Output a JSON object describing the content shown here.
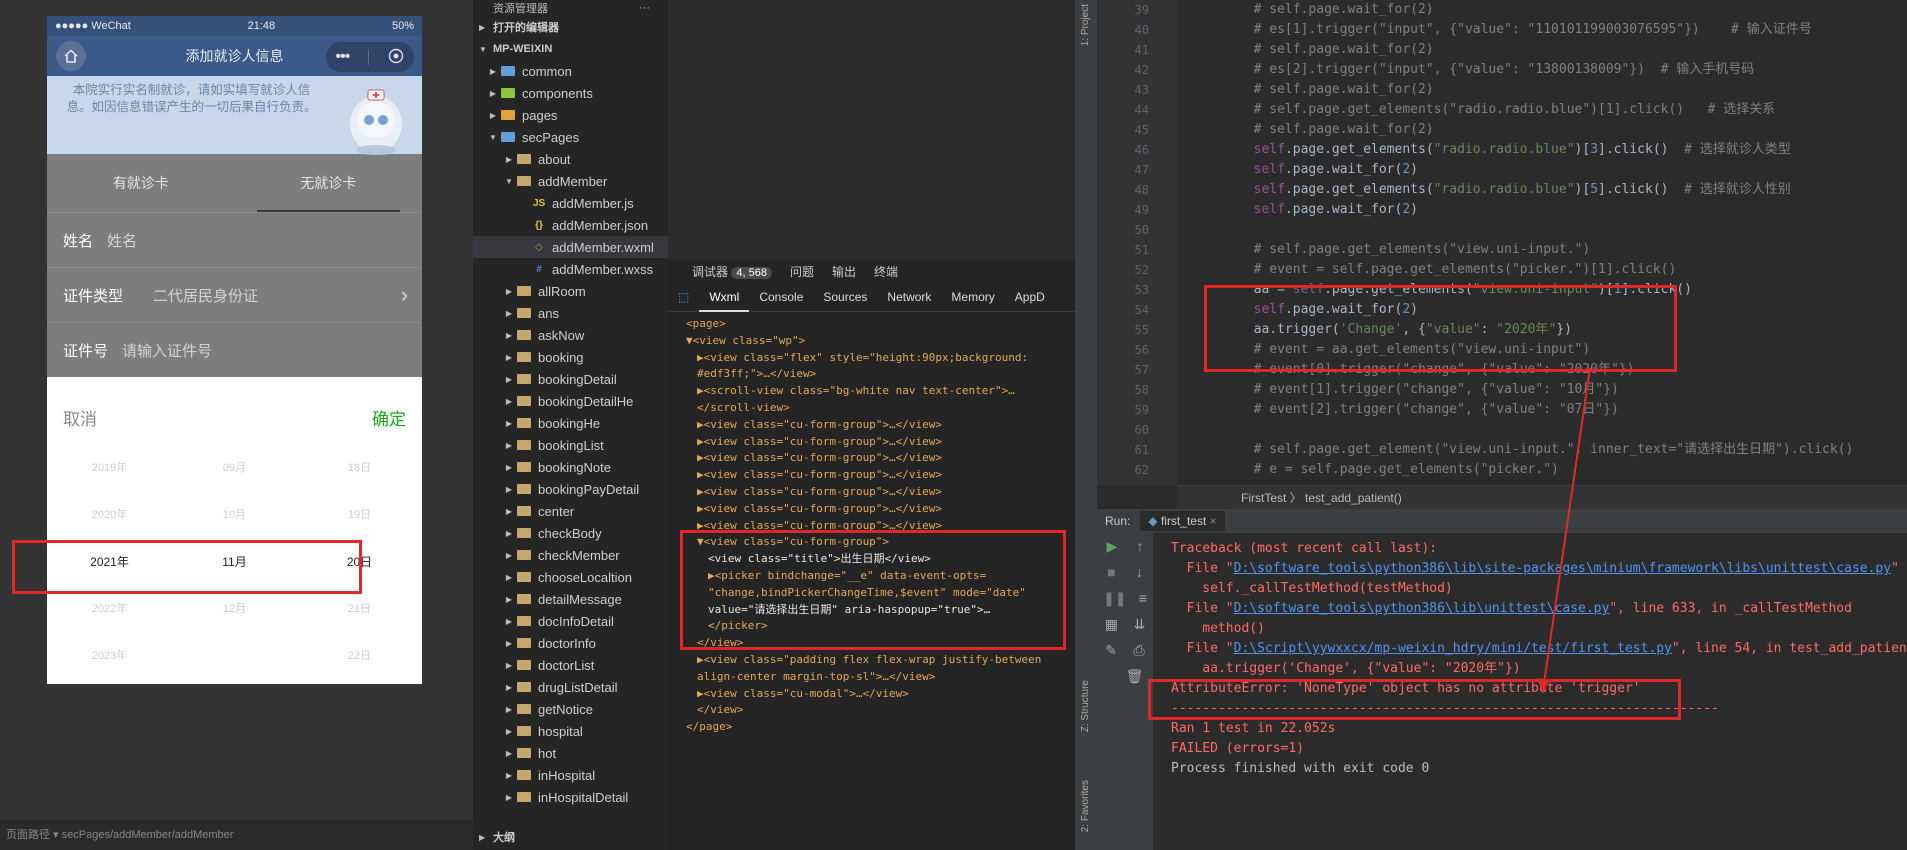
{
  "simulator": {
    "status_carrier": "●●●●● WeChat",
    "status_time": "21:48",
    "status_battery": "50%",
    "nav_title": "添加就诊人信息",
    "notice": "本院实行实名制就诊，请如实填写就诊人信息。如因信息错误产生的一切后果自行负责。",
    "tabs": [
      "有就诊卡",
      "无就诊卡"
    ],
    "fields": [
      {
        "label": "姓名",
        "placeholder": "姓名"
      },
      {
        "label": "证件类型",
        "placeholder": "二代居民身份证"
      },
      {
        "label": "证件号",
        "placeholder": "请输入证件号"
      }
    ],
    "picker": {
      "cancel": "取消",
      "confirm": "确定",
      "rows": [
        [
          "2019年",
          "09月",
          "18日"
        ],
        [
          "2020年",
          "10月",
          "19日"
        ],
        [
          "2021年",
          "11月",
          "20日"
        ],
        [
          "2022年",
          "12月",
          "21日"
        ],
        [
          "2023年",
          "",
          "22日"
        ]
      ]
    },
    "bottom_path": "页面路径  ▾  secPages/addMember/addMember"
  },
  "explorer": {
    "title": "资源管理器",
    "more": "···",
    "open_editors": "打开的编辑器",
    "project": "MP-WEIXIN",
    "outline": "大纲",
    "items": [
      {
        "label": "common",
        "depth": 1,
        "type": "folder",
        "tri": "▶"
      },
      {
        "label": "components",
        "depth": 1,
        "type": "folder-green",
        "tri": "▶"
      },
      {
        "label": "pages",
        "depth": 1,
        "type": "folder-orange",
        "tri": "▶"
      },
      {
        "label": "secPages",
        "depth": 1,
        "type": "folder",
        "tri": "▼"
      },
      {
        "label": "about",
        "depth": 2,
        "type": "folder",
        "tri": "▶"
      },
      {
        "label": "addMember",
        "depth": 2,
        "type": "folder",
        "tri": "▼"
      },
      {
        "label": "addMember.js",
        "depth": 3,
        "type": "js",
        "tri": ""
      },
      {
        "label": "addMember.json",
        "depth": 3,
        "type": "json",
        "tri": ""
      },
      {
        "label": "addMember.wxml",
        "depth": 3,
        "type": "wxml",
        "tri": "",
        "selected": true
      },
      {
        "label": "addMember.wxss",
        "depth": 3,
        "type": "wxss",
        "tri": ""
      },
      {
        "label": "allRoom",
        "depth": 2,
        "type": "folder",
        "tri": "▶"
      },
      {
        "label": "ans",
        "depth": 2,
        "type": "folder",
        "tri": "▶"
      },
      {
        "label": "askNow",
        "depth": 2,
        "type": "folder",
        "tri": "▶"
      },
      {
        "label": "booking",
        "depth": 2,
        "type": "folder",
        "tri": "▶"
      },
      {
        "label": "bookingDetail",
        "depth": 2,
        "type": "folder",
        "tri": "▶"
      },
      {
        "label": "bookingDetailHe",
        "depth": 2,
        "type": "folder",
        "tri": "▶"
      },
      {
        "label": "bookingHe",
        "depth": 2,
        "type": "folder",
        "tri": "▶"
      },
      {
        "label": "bookingList",
        "depth": 2,
        "type": "folder",
        "tri": "▶"
      },
      {
        "label": "bookingNote",
        "depth": 2,
        "type": "folder",
        "tri": "▶"
      },
      {
        "label": "bookingPayDetail",
        "depth": 2,
        "type": "folder",
        "tri": "▶"
      },
      {
        "label": "center",
        "depth": 2,
        "type": "folder",
        "tri": "▶"
      },
      {
        "label": "checkBody",
        "depth": 2,
        "type": "folder",
        "tri": "▶"
      },
      {
        "label": "checkMember",
        "depth": 2,
        "type": "folder",
        "tri": "▶"
      },
      {
        "label": "chooseLocaltion",
        "depth": 2,
        "type": "folder",
        "tri": "▶"
      },
      {
        "label": "detailMessage",
        "depth": 2,
        "type": "folder",
        "tri": "▶"
      },
      {
        "label": "docInfoDetail",
        "depth": 2,
        "type": "folder",
        "tri": "▶"
      },
      {
        "label": "doctorInfo",
        "depth": 2,
        "type": "folder",
        "tri": "▶"
      },
      {
        "label": "doctorList",
        "depth": 2,
        "type": "folder",
        "tri": "▶"
      },
      {
        "label": "drugListDetail",
        "depth": 2,
        "type": "folder",
        "tri": "▶"
      },
      {
        "label": "getNotice",
        "depth": 2,
        "type": "folder",
        "tri": "▶"
      },
      {
        "label": "hospital",
        "depth": 2,
        "type": "folder",
        "tri": "▶"
      },
      {
        "label": "hot",
        "depth": 2,
        "type": "folder",
        "tri": "▶"
      },
      {
        "label": "inHospital",
        "depth": 2,
        "type": "folder",
        "tri": "▶"
      },
      {
        "label": "inHospitalDetail",
        "depth": 2,
        "type": "folder",
        "tri": "▶"
      }
    ]
  },
  "devtools": {
    "top_tabs": [
      "调试器",
      "问题",
      "输出",
      "终端"
    ],
    "badge": "4, 568",
    "tabs": [
      "Wxml",
      "Console",
      "Sources",
      "Network",
      "Memory",
      "AppD"
    ],
    "dom_lines": [
      {
        "indent": 0,
        "text": "<page>"
      },
      {
        "indent": 0,
        "text": "▼<view class=\"wp\">"
      },
      {
        "indent": 1,
        "text": "▶<view class=\"flex\" style=\"height:90px;background:"
      },
      {
        "indent": 1,
        "text": "#edf3ff;\">…</view>"
      },
      {
        "indent": 1,
        "text": "▶<scroll-view class=\"bg-white nav text-center\">…"
      },
      {
        "indent": 1,
        "text": "</scroll-view>"
      },
      {
        "indent": 1,
        "text": "▶<view class=\"cu-form-group\">…</view>"
      },
      {
        "indent": 1,
        "text": "▶<view class=\"cu-form-group\">…</view>"
      },
      {
        "indent": 1,
        "text": "▶<view class=\"cu-form-group\">…</view>"
      },
      {
        "indent": 1,
        "text": "▶<view class=\"cu-form-group\">…</view>"
      },
      {
        "indent": 1,
        "text": "▶<view class=\"cu-form-group\">…</view>"
      },
      {
        "indent": 1,
        "text": "▶<view class=\"cu-form-group\">…</view>"
      },
      {
        "indent": 1,
        "text": "▶<view class=\"cu-form-group\">…</view>"
      },
      {
        "indent": 1,
        "text": "▼<view class=\"cu-form-group\">"
      },
      {
        "indent": 2,
        "text": "<view class=\"title\">出生日期</view>"
      },
      {
        "indent": 2,
        "text": "▶<picker bindchange=\"__e\" data-event-opts="
      },
      {
        "indent": 2,
        "text": "\"change,bindPickerChangeTime,$event\" mode=\"date\""
      },
      {
        "indent": 2,
        "text": "value=\"请选择出生日期\" aria-haspopup=\"true\">…"
      },
      {
        "indent": 2,
        "text": "</picker>"
      },
      {
        "indent": 1,
        "text": "</view>"
      },
      {
        "indent": 1,
        "text": "▶<view class=\"padding flex flex-wrap justify-between"
      },
      {
        "indent": 1,
        "text": "align-center margin-top-sl\">…</view>"
      },
      {
        "indent": 1,
        "text": "▶<view class=\"cu-modal\">…</view>"
      },
      {
        "indent": 1,
        "text": "</view>"
      },
      {
        "indent": 0,
        "text": "</page>"
      }
    ]
  },
  "ide": {
    "side_tabs": [
      "1: Project",
      "Z: Structure",
      "2: Favorites"
    ],
    "code_lines": [
      {
        "n": "39",
        "parts": [
          [
            "cm",
            "# self.page.wait_for(2)"
          ]
        ],
        "ind": 2
      },
      {
        "n": "40",
        "parts": [
          [
            "cm",
            "# es[1].trigger(\"input\", {\"value\": \"110101199003076595\"})    # 输入证件号"
          ]
        ],
        "ind": 2
      },
      {
        "n": "41",
        "parts": [
          [
            "cm",
            "# self.page.wait_for(2)"
          ]
        ],
        "ind": 2
      },
      {
        "n": "42",
        "parts": [
          [
            "cm",
            "# es[2].trigger(\"input\", {\"value\": \"13800138009\"})  # 输入手机号码"
          ]
        ],
        "ind": 2
      },
      {
        "n": "43",
        "parts": [
          [
            "cm",
            "# self.page.wait_for(2)"
          ]
        ],
        "ind": 2
      },
      {
        "n": "44",
        "parts": [
          [
            "cm",
            "# self.page.get_elements(\"radio.radio.blue\")[1].click()   # 选择关系"
          ]
        ],
        "ind": 2
      },
      {
        "n": "45",
        "parts": [
          [
            "cm",
            "# self.page.wait_for(2)"
          ]
        ],
        "ind": 2
      },
      {
        "n": "46",
        "parts": [
          [
            "sf",
            "self"
          ],
          [
            "d",
            ".page.get_elements("
          ],
          [
            "s",
            "\"radio.radio.blue\""
          ],
          [
            "d",
            ")["
          ],
          [
            "n",
            "3"
          ],
          [
            "d",
            "].click()  "
          ],
          [
            "cm",
            "# 选择就诊人类型"
          ]
        ],
        "ind": 2
      },
      {
        "n": "47",
        "parts": [
          [
            "sf",
            "self"
          ],
          [
            "d",
            ".page.wait_for("
          ],
          [
            "n",
            "2"
          ],
          [
            "d",
            ")"
          ]
        ],
        "ind": 2
      },
      {
        "n": "48",
        "parts": [
          [
            "sf",
            "self"
          ],
          [
            "d",
            ".page.get_elements("
          ],
          [
            "s",
            "\"radio.radio.blue\""
          ],
          [
            "d",
            ")["
          ],
          [
            "n",
            "5"
          ],
          [
            "d",
            "].click()  "
          ],
          [
            "cm",
            "# 选择就诊人性别"
          ]
        ],
        "ind": 2
      },
      {
        "n": "49",
        "parts": [
          [
            "sf",
            "self"
          ],
          [
            "d",
            ".page.wait_for("
          ],
          [
            "n",
            "2"
          ],
          [
            "d",
            ")"
          ]
        ],
        "ind": 2
      },
      {
        "n": "50",
        "parts": [],
        "ind": 2
      },
      {
        "n": "51",
        "parts": [
          [
            "cm",
            "# self.page.get_elements(\"view.uni-input.\")"
          ]
        ],
        "ind": 2
      },
      {
        "n": "52",
        "parts": [
          [
            "cm",
            "# event = self.page.get_elements(\"picker.\")[1].click()"
          ]
        ],
        "ind": 2
      },
      {
        "n": "53",
        "parts": [
          [
            "d",
            "aa = "
          ],
          [
            "sf",
            "self"
          ],
          [
            "d",
            ".page.get_elements("
          ],
          [
            "s",
            "\"view.uni-input\""
          ],
          [
            "d",
            ")["
          ],
          [
            "n",
            "1"
          ],
          [
            "d",
            "].click()"
          ]
        ],
        "ind": 2
      },
      {
        "n": "54",
        "parts": [
          [
            "sf",
            "self"
          ],
          [
            "d",
            ".page.wait_for("
          ],
          [
            "n",
            "2"
          ],
          [
            "d",
            ")"
          ]
        ],
        "ind": 2
      },
      {
        "n": "55",
        "parts": [
          [
            "d",
            "aa.trigger("
          ],
          [
            "s",
            "'Change'"
          ],
          [
            "d",
            ", {"
          ],
          [
            "s",
            "\"value\""
          ],
          [
            "d",
            ": "
          ],
          [
            "s",
            "\"2020年\""
          ],
          [
            "d",
            "})"
          ]
        ],
        "ind": 2
      },
      {
        "n": "56",
        "parts": [
          [
            "cm",
            "# event = aa.get_elements(\"view.uni-input\")"
          ]
        ],
        "ind": 2
      },
      {
        "n": "57",
        "parts": [
          [
            "cm",
            "# event[0].trigger(\"change\", {\"value\": \"2020年\"})"
          ]
        ],
        "ind": 2
      },
      {
        "n": "58",
        "parts": [
          [
            "cm",
            "# event[1].trigger(\"change\", {\"value\": \"10月\"})"
          ]
        ],
        "ind": 2
      },
      {
        "n": "59",
        "parts": [
          [
            "cm",
            "# event[2].trigger(\"change\", {\"value\": \"07日\"})"
          ]
        ],
        "ind": 2
      },
      {
        "n": "60",
        "parts": [],
        "ind": 2
      },
      {
        "n": "61",
        "parts": [
          [
            "cm",
            "# self.page.get_element(\"view.uni-input.\", inner_text=\"请选择出生日期\").click()"
          ]
        ],
        "ind": 2
      },
      {
        "n": "62",
        "parts": [
          [
            "cm",
            "# e = self.page.get_elements(\"picker.\")"
          ]
        ],
        "ind": 2
      }
    ],
    "breadcrumb": "FirstTest  〉  test_add_patient()",
    "run_label": "Run:",
    "run_tab": "first_test",
    "console_lines": [
      {
        "cls": "err",
        "parts": [
          [
            "err",
            "Traceback (most recent call last):"
          ]
        ],
        "ind": 0
      },
      {
        "cls": "err",
        "parts": [
          [
            "err",
            "  File \""
          ],
          [
            "link",
            "D:\\software_tools\\python386\\lib\\site-packages\\minium\\framework\\libs\\unittest\\case.py"
          ],
          [
            "err",
            "\""
          ]
        ],
        "ind": 0
      },
      {
        "cls": "err",
        "parts": [
          [
            "err",
            "    self._callTestMethod(testMethod)"
          ]
        ],
        "ind": 0
      },
      {
        "cls": "err",
        "parts": [
          [
            "err",
            "  File \""
          ],
          [
            "link",
            "D:\\software_tools\\python386\\lib\\unittest\\case.py"
          ],
          [
            "err",
            "\", line 633, in _callTestMethod"
          ]
        ],
        "ind": 0
      },
      {
        "cls": "err",
        "parts": [
          [
            "err",
            "    method()"
          ]
        ],
        "ind": 0
      },
      {
        "cls": "err",
        "parts": [
          [
            "err",
            "  File \""
          ],
          [
            "link",
            "D:\\Script\\yywxxcx/mp-weixin_hdry/mini/test/first_test.py"
          ],
          [
            "err",
            "\", line 54, in test_add_patient"
          ]
        ],
        "ind": 0
      },
      {
        "cls": "err",
        "parts": [
          [
            "err",
            "    aa.trigger('Change', {\"value\": \"2020年\"})"
          ]
        ],
        "ind": 0
      },
      {
        "cls": "err",
        "parts": [
          [
            "err",
            "AttributeError: 'NoneType' object has no attribute 'trigger'"
          ]
        ],
        "ind": 0
      },
      {
        "cls": "err",
        "parts": [
          [
            "err",
            ""
          ]
        ],
        "ind": 0
      },
      {
        "cls": "err",
        "parts": [
          [
            "err",
            "----------------------------------------------------------------------"
          ]
        ],
        "ind": 0
      },
      {
        "cls": "err",
        "parts": [
          [
            "err",
            "Ran 1 test in 22.052s"
          ]
        ],
        "ind": 0
      },
      {
        "cls": "err",
        "parts": [
          [
            "err",
            ""
          ]
        ],
        "ind": 0
      },
      {
        "cls": "err",
        "parts": [
          [
            "err",
            "FAILED (errors=1)"
          ]
        ],
        "ind": 0
      },
      {
        "cls": "err",
        "parts": [
          [
            "err",
            ""
          ]
        ],
        "ind": 0
      },
      {
        "cls": "norm",
        "parts": [
          [
            "norm",
            "Process finished with exit code 0"
          ]
        ],
        "ind": 0
      }
    ]
  },
  "colors": {
    "highlight_box": "#e02828",
    "error_text": "#ff6b68",
    "link": "#5394ec"
  }
}
